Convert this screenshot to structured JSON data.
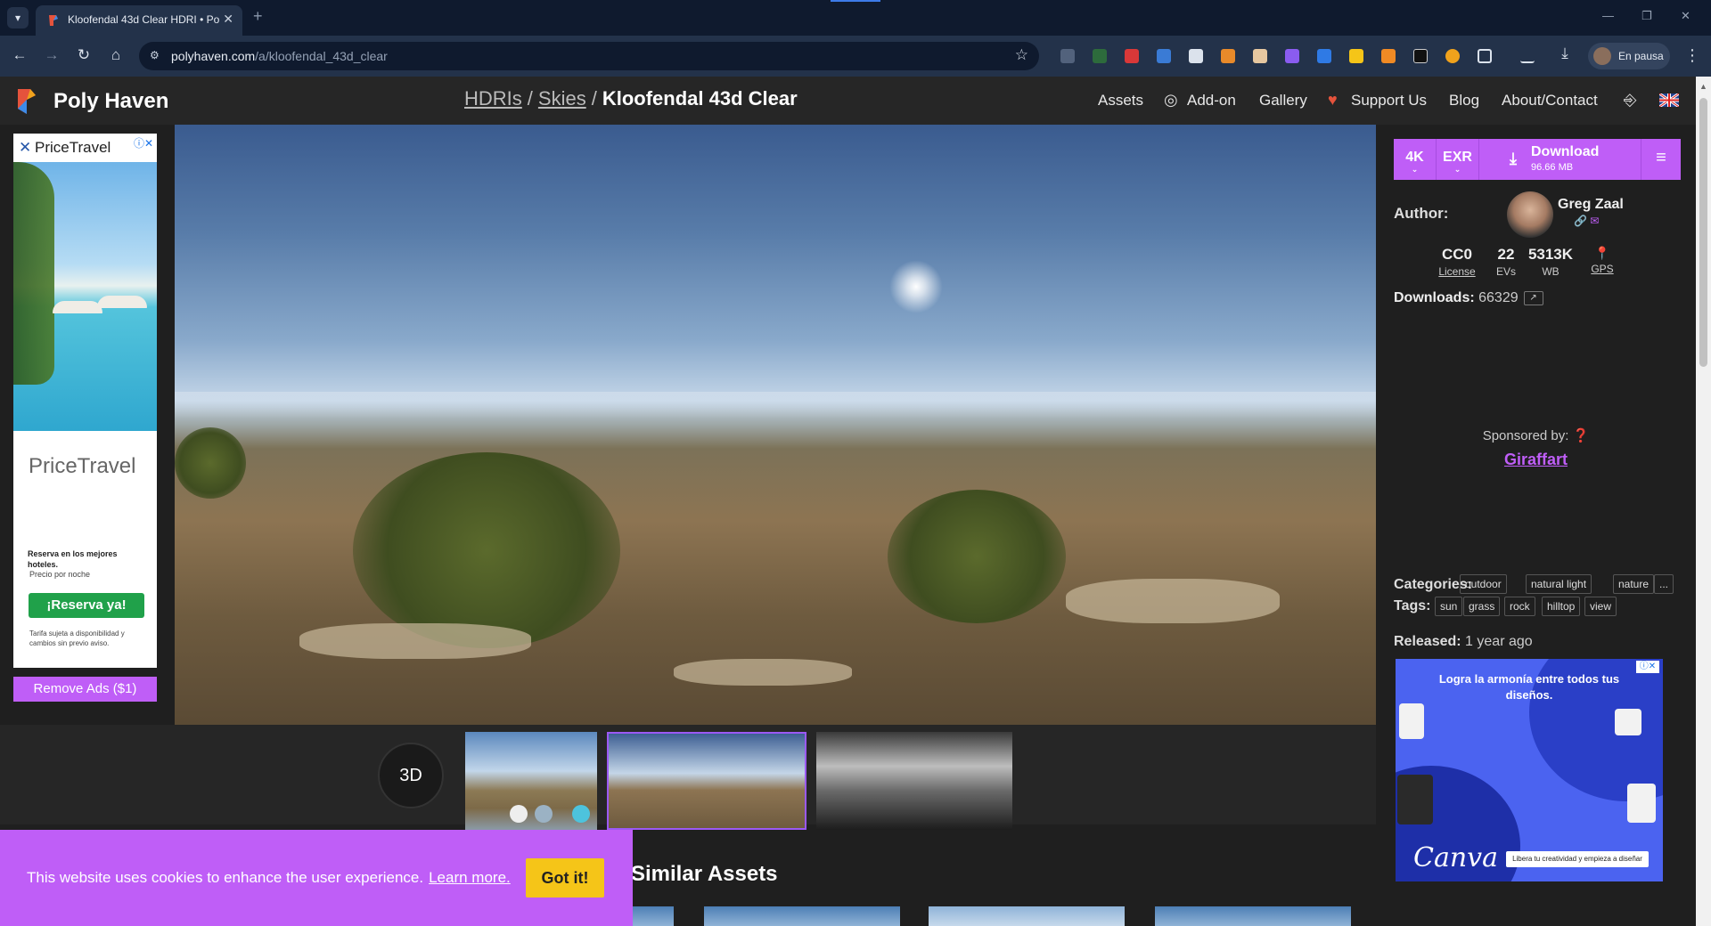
{
  "browser": {
    "tab_title": "Kloofendal 43d Clear HDRI • Po",
    "url_host": "polyhaven.com",
    "url_path": "/a/kloofendal_43d_clear",
    "profile_status": "En pausa"
  },
  "site": {
    "brand": "Poly Haven",
    "accent_color": "#bf5ef7",
    "breadcrumb": [
      {
        "label": "HDRIs"
      },
      {
        "label": "Skies"
      }
    ],
    "breadcrumb_current": "Kloofendal 43d Clear",
    "nav": {
      "assets": "Assets",
      "addon": "Add-on",
      "gallery": "Gallery",
      "support": "Support Us",
      "blog": "Blog",
      "about": "About/Contact"
    }
  },
  "left_ad": {
    "brand": "PriceTravel",
    "title": "PriceTravel",
    "line1": "Reserva en los mejores hoteles.",
    "line2": "Precio por noche",
    "cta": "¡Reserva ya!",
    "disclaimer": "Tarifa sujeta a disponibilidad y cambios sin previo aviso.",
    "remove_ads": "Remove Ads ($1)"
  },
  "viewer": {
    "btn_3d": "3D"
  },
  "download": {
    "resolution": "4K",
    "format": "EXR",
    "label": "Download",
    "size": "96.66 MB"
  },
  "info": {
    "author_label": "Author:",
    "author_name": "Greg Zaal",
    "stats": [
      {
        "value": "CC0",
        "label": "License"
      },
      {
        "value": "22",
        "label": "EVs"
      },
      {
        "value": "5313K",
        "label": "WB"
      },
      {
        "value": "",
        "label": "GPS"
      }
    ],
    "downloads_label": "Downloads:",
    "downloads_value": "66329",
    "sponsored_label": "Sponsored by:",
    "sponsor": "Giraffart",
    "categories_label": "Categories:",
    "categories": [
      "outdoor",
      "natural light",
      "nature",
      "..."
    ],
    "tags_label": "Tags:",
    "tags": [
      "sun",
      "grass",
      "rock",
      "hilltop",
      "view"
    ],
    "released_label": "Released:",
    "released_value": "1 year ago"
  },
  "right_ad": {
    "message": "Logra la armonía entre todos tus diseños.",
    "brand": "Canva",
    "pill": "Libera tu creatividad y empieza a diseñar"
  },
  "similar": {
    "title": "Similar Assets"
  },
  "cookie": {
    "text": "This website uses cookies to enhance the user experience.",
    "link": "Learn more.",
    "button": "Got it!"
  }
}
